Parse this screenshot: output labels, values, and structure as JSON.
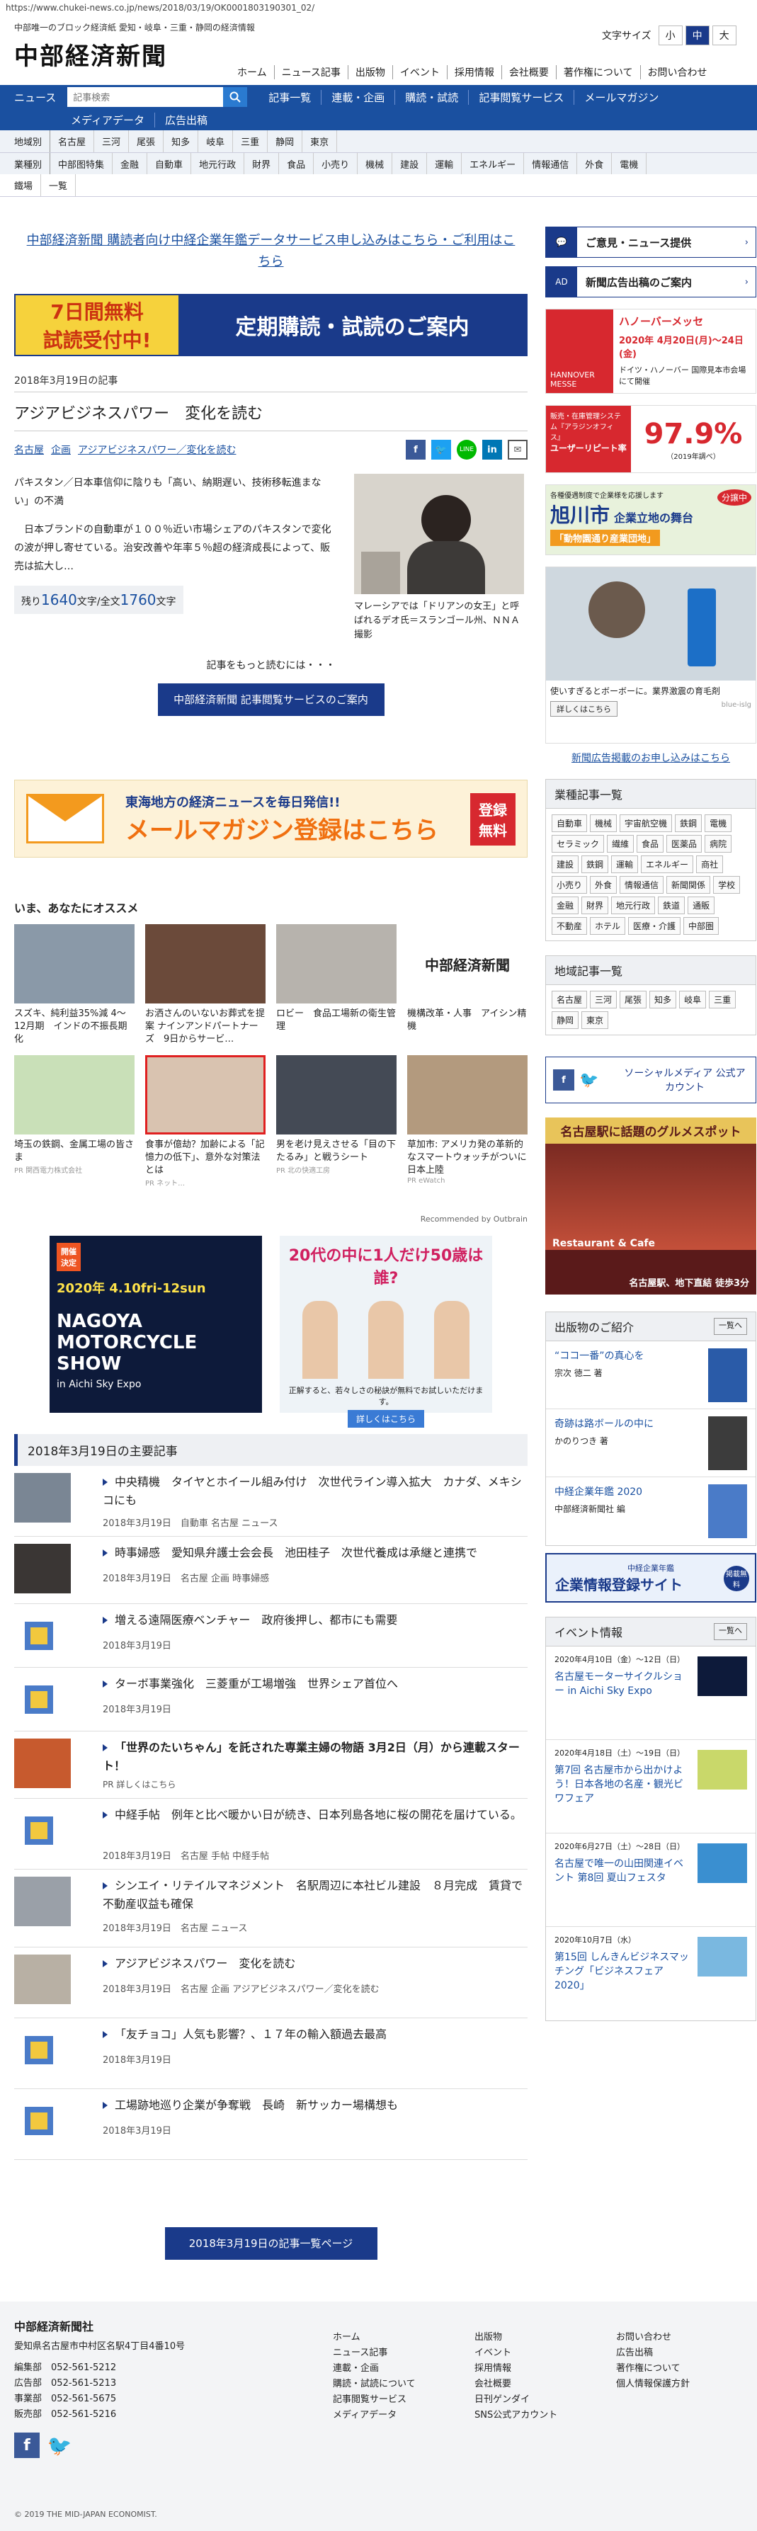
{
  "browser": {
    "url": "https://www.chukei-news.co.jp/news/2018/03/19/OK0001803190301_02/"
  },
  "header": {
    "tagline": "中部唯一のブロック経済紙 愛知・岐阜・三重・静岡の経済情報",
    "logo": "中部経済新聞",
    "font_size_label": "文字サイズ",
    "font_sizes": [
      "小",
      "中",
      "大"
    ],
    "nav": [
      "ホーム",
      "ニュース記事",
      "出版物",
      "イベント",
      "採用情報",
      "会社概要",
      "著作権について",
      "お問い合わせ"
    ]
  },
  "bar": {
    "news_label": "ニュース",
    "search_placeholder": "記事検索",
    "items": [
      "記事一覧",
      "連載・企画",
      "購読・試読",
      "記事閲覧サービス",
      "メールマガジン"
    ],
    "items2": [
      "メディアデータ",
      "広告出稿"
    ]
  },
  "regions": {
    "label": "地域別",
    "items": [
      "名古屋",
      "三河",
      "尾張",
      "知多",
      "岐阜",
      "三重",
      "静岡",
      "東京"
    ]
  },
  "industries": {
    "label": "業種別",
    "items": [
      "中部图特集",
      "金融",
      "自動車",
      "地元行政",
      "財界",
      "食品",
      "小売り",
      "機械",
      "建設",
      "運輸",
      "エネルギー",
      "情報通信",
      "外食",
      "電機"
    ],
    "extra": [
      "鐵場",
      "一覧"
    ]
  },
  "main": {
    "promo_link": "中部経済新聞 購読者向け中経企業年鑑データサービス申し込みはこちら・ご利用はこちら",
    "sub_banner": {
      "left1": "7日間無料",
      "left2": "試読受付中!",
      "right": "定期購読・試読のご案内"
    },
    "article_date": "2018年3月19日の記事",
    "article_title": "アジアビジネスパワー　変化を読む",
    "tags": [
      "名古屋",
      "企画",
      "アジアビジネスパワー／変化を読む"
    ],
    "lead1": "パキスタン／日本車信仰に陰りも「高い、納期遅い、技術移転進まない」の不満",
    "lead2": "　日本ブランドの自動車が１００％近い市場シェアのパキスタンで変化の波が押し寄せている。治安改善や年率５％超の経済成長によって、販売は拡大し…",
    "photo_caption": "マレーシアでは「ドリアンの女王」と呼ばれるデオ氏＝スランゴール州、ＮＮＡ撮影",
    "remaining": {
      "prefix": "残り",
      "left": "1640",
      "mid": "文字/全文",
      "total": "1760",
      "suffix": "文字"
    },
    "more_text": "記事をもっと読むには・・・",
    "service_button": "中部経済新聞 記事閲覧サービスのご案内",
    "mail_banner": {
      "line1": "東海地方の経済ニュースを毎日発信!!",
      "line2": "メールマガジン登録はこちら",
      "badge1": "登録",
      "badge2": "無料"
    },
    "recommend_title": "いま、あなたにオススメ",
    "recommend": [
      {
        "caption": "スズキ、純利益35%減 4～12月期　インドの不振長期化",
        "source": ""
      },
      {
        "caption": "お洒さんのいないお葬式を提案 ナインアンドパートナーズ　9日からサービ…",
        "source": ""
      },
      {
        "caption": "ロビー　食品工場新の衛生管理",
        "source": ""
      },
      {
        "caption": "機構改革・人事　アイシン精機",
        "source": ""
      },
      {
        "caption": "埼玉の鉄鋼、金属工場の皆さま",
        "source": "PR 関西電力株式会社"
      },
      {
        "caption": "食事が億劫？加齢による「記憶力の低下」、意外な対策法とは",
        "source": "PR ネット…"
      },
      {
        "caption": "男を老け見えさせる「目の下たるみ」と戦うシート",
        "source": "PR 北の快適工房"
      },
      {
        "caption": "草加市: アメリカ発の革新的なスマートウォッチがついに日本上陸",
        "source": "PR eWatch"
      }
    ],
    "outbrain": "Recommended by Outbrain",
    "ad_moto": {
      "tag1": "開催",
      "tag2": "決定",
      "date": "2020年 4.10fri-12sun",
      "title": "NAGOYA MOTORCYCLE SHOW",
      "venue": "in Aichi Sky Expo"
    },
    "ad_socks": {
      "line1": "20代の中に1人だけ50歳は誰?",
      "line2": "正解すると、若々しさの秘訣が無料でお試しいただけます。",
      "btn": "詳しくはこちら"
    },
    "daily_title": "2018年3月19日の主要記事",
    "daily": [
      {
        "title": "中央精機　タイヤとホイール組み付け　次世代ライン導入拡大　カナダ、メキシコにも",
        "date": "2018年3月19日",
        "tags": "自動車 名古屋 ニュース"
      },
      {
        "title": "時事婦感　愛知県弁護士会会長　池田桂子　次世代養成は承継と連携で",
        "date": "2018年3月19日",
        "tags": "名古屋 企画 時事婦感"
      },
      {
        "title": "増える遠隔医療ベンチャー　政府後押し、都市にも需要",
        "date": "2018年3月19日",
        "tags": ""
      },
      {
        "title": "ターボ事業強化　三菱重が工場増強　世界シェア首位へ",
        "date": "2018年3月19日",
        "tags": ""
      },
      {
        "title": "「世界のたいちゃん」を託された専業主婦の物語 3月2日（月）から連載スタート！",
        "date": "PR 詳しくはこちら",
        "tags": ""
      },
      {
        "title": "中経手帖　例年と比べ暖かい日が続き、日本列島各地に桜の開花を届けている。",
        "date": "2018年3月19日",
        "tags": "名古屋 手帖 中経手帖"
      },
      {
        "title": "シンエイ・リテイルマネジメント　名駅周辺に本社ビル建設　８月完成　賃貸で不動産収益も確保",
        "date": "2018年3月19日",
        "tags": "名古屋 ニュース"
      },
      {
        "title": "アジアビジネスパワー　変化を読む",
        "date": "2018年3月19日",
        "tags": "名古屋 企画 アジアビジネスパワー／変化を読む"
      },
      {
        "title": "「友チョコ」人気も影響？、１７年の輸入額過去最高",
        "date": "2018年3月19日",
        "tags": ""
      },
      {
        "title": "工場跡地巡り企業が争奪戦　長崎　新サッカー場構想も",
        "date": "2018年3月19日",
        "tags": ""
      }
    ],
    "list_button": "2018年3月19日の記事一覧ページ"
  },
  "side": {
    "opinion": "ご意見・ニュース提供",
    "ad_info": "新聞広告出稿のご案内",
    "hannover": {
      "brand": "HANNOVER MESSE",
      "title": "ハノーバーメッセ",
      "date": "2020年 4月20日(月)～24日(金)",
      "place": "ドイツ・ハノーバー 国際見本市会場にて開催"
    },
    "shunpan": {
      "top": "販売・在庫管理システム『アラジンオフィス』",
      "label": "ユーザーリピート率",
      "value": "97.9%",
      "note": "（2019年調べ）"
    },
    "asahikawa": {
      "top": "各種優遇制度で企業様を応援します",
      "city": "旭川市",
      "sub": "企業立地の舞台",
      "badge": "分譲中",
      "park": "「動物園通り産業団地」"
    },
    "hair": {
      "caption": "使いすぎるとボーボーに。業界激震の育毛剤",
      "btn": "詳しくはこちら",
      "src": "blue-islg"
    },
    "news_ad_link": "新聞広告掲載のお申し込みはこちら",
    "industry_title": "業種記事一覧",
    "industry_chips": [
      "自動車",
      "機械",
      "宇宙航空機",
      "鉄鋼",
      "電機",
      "セラミック",
      "繊維",
      "食品",
      "医薬品",
      "病院",
      "建設",
      "鉄鋼",
      "運輸",
      "エネルギー",
      "商社",
      "小売り",
      "外食",
      "情報通信",
      "新聞関係",
      "学校",
      "金融",
      "財界",
      "地元行政",
      "鉄道",
      "通販",
      "不動産",
      "ホテル",
      "医療・介護",
      "中部圏"
    ],
    "region_title": "地域記事一覧",
    "region_chips": [
      "名古屋",
      "三河",
      "尾張",
      "知多",
      "岐阜",
      "三重",
      "静岡",
      "東京"
    ],
    "social": "ソーシャルメディア 公式アカウント",
    "gourmet": {
      "title": "名古屋駅に話題のグルメスポット",
      "name": "Restaurant & Cafe",
      "loc": "名古屋駅、地下直結 徒歩3分"
    },
    "pub_title": "出版物のご紹介",
    "pub_more": "一覧へ",
    "pubs": [
      {
        "title": "“ココ一番”の真心を",
        "author": "宗次 徳二 著"
      },
      {
        "title": "奇跡は路ボールの中に",
        "author": "かのりつき 著"
      },
      {
        "title": "中経企業年鑑 2020",
        "author": "中部経済新聞社 編"
      }
    ],
    "kigyou": {
      "sub": "中経企業年鑑",
      "title": "企業情報登録サイト",
      "badge": "掲載無料"
    },
    "event_title": "イベント情報",
    "event_more": "一覧へ",
    "events": [
      {
        "date": "2020年4月10日（金）～12日（日）",
        "title": "名古屋モーターサイクルショー in Aichi Sky Expo"
      },
      {
        "date": "2020年4月18日（土）～19日（日）",
        "title": "第7回 名古屋市から出かけよう！日本各地の名産・観光ビワフェア"
      },
      {
        "date": "2020年6月27日（土）～28日（日）",
        "title": "名古屋で唯一の山田関連イベント 第8回 夏山フェスタ"
      },
      {
        "date": "2020年10月7日（水）",
        "title": "第15回 しんきんビジネスマッチング「ビジネスフェア2020」"
      }
    ]
  },
  "footer": {
    "company": "中部経済新聞社",
    "address": "愛知県名古屋市中村区名駅4丁目4番10号",
    "phones": [
      {
        "label": "編集部",
        "num": "052-561-5212"
      },
      {
        "label": "広告部",
        "num": "052-561-5213"
      },
      {
        "label": "事業部",
        "num": "052-561-5675"
      },
      {
        "label": "販売部",
        "num": "052-561-5216"
      }
    ],
    "col1": [
      "ホーム",
      "ニュース記事",
      "連載・企画",
      "購読・試読について",
      "記事閲覧サービス",
      "メディアデータ"
    ],
    "col2": [
      "出版物",
      "イベント",
      "採用情報",
      "会社概要",
      "日刊ゲンダイ",
      "SNS公式アカウント"
    ],
    "col3": [
      "お問い合わせ",
      "広告出稿",
      "著作権について",
      "個人情報保護方針"
    ],
    "copyright": "© 2019 THE MID-JAPAN ECONOMIST."
  }
}
